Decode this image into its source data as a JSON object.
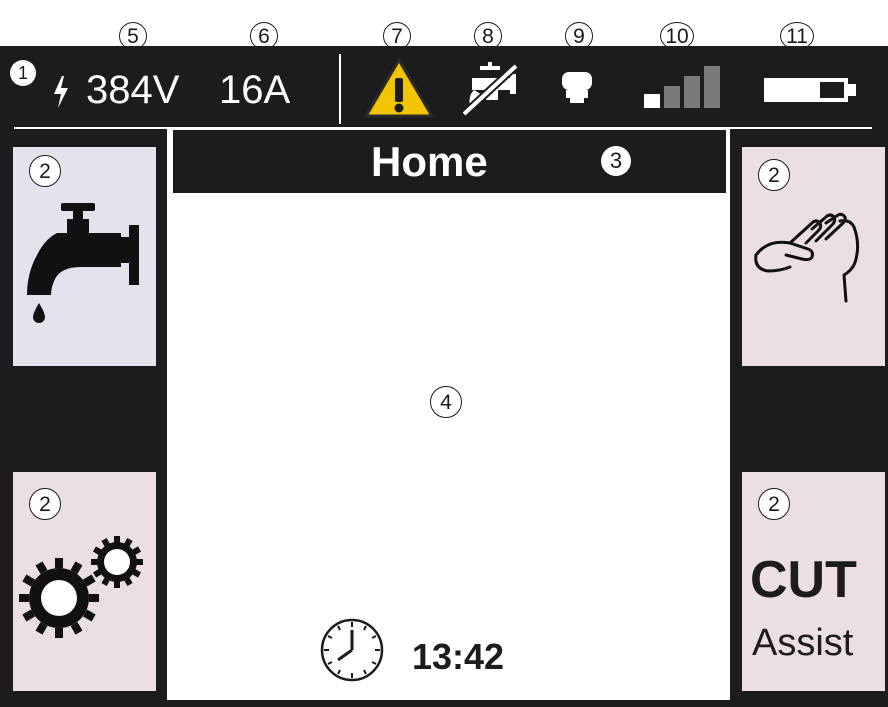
{
  "callouts": {
    "c1": "1",
    "c2a": "2",
    "c2b": "2",
    "c2c": "2",
    "c2d": "2",
    "c3": "3",
    "c4": "4",
    "c5": "5",
    "c6": "6",
    "c7": "7",
    "c8": "8",
    "c9": "9",
    "c10": "10",
    "c11": "11"
  },
  "status": {
    "voltage": "384V",
    "current": "16A",
    "icons": [
      "lightning-icon",
      "warning-icon",
      "water-off-icon",
      "nozzle-icon",
      "signal-icon",
      "battery-icon"
    ],
    "signal_bars_active": 1,
    "signal_bars_total": 4,
    "battery_level": 0.7
  },
  "header": {
    "title": "Home"
  },
  "tiles": {
    "top_left": {
      "icon": "water-tap-icon"
    },
    "bottom_left": {
      "icon": "gears-icon"
    },
    "top_right": {
      "icon": "hand-icon"
    },
    "bottom_right": {
      "label_main": "CUT",
      "label_sub": "Assist"
    }
  },
  "footer": {
    "time": "13:42",
    "icon": "clock-icon"
  },
  "colors": {
    "frame": "#1c1c1c",
    "tile_blue": "#e3e3ee",
    "tile_pink": "#ecdfe3",
    "warning": "#f3c400"
  }
}
